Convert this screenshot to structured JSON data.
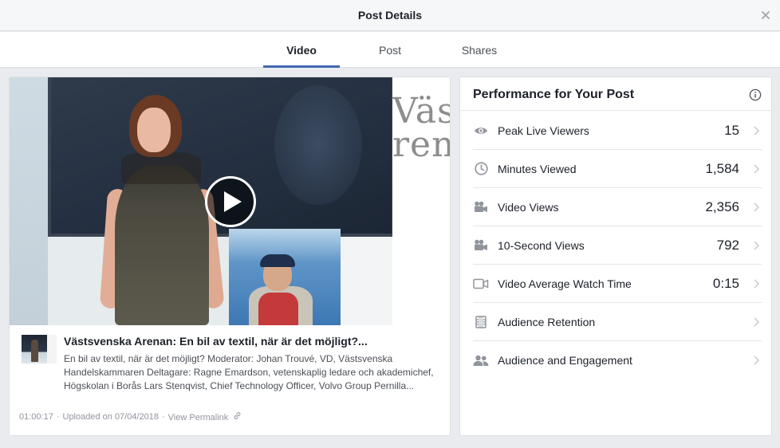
{
  "dialog": {
    "title": "Post Details",
    "close_icon": "close-icon"
  },
  "tabs": [
    {
      "label": "Video",
      "active": true
    },
    {
      "label": "Post",
      "active": false
    },
    {
      "label": "Shares",
      "active": false
    }
  ],
  "video": {
    "banner_text": "Väst\nren",
    "title": "Västsvenska Arenan: En bil av textil, när är det möjligt?...",
    "description": "En bil av textil, när är det möjligt? Moderator: Johan Trouvé, VD, Västsvenska Handelskammaren Deltagare: Ragne Emardson, vetenskaplig ledare och akademichef, Högskolan i Borås Lars Stenqvist, Chief Technology Officer, Volvo Group Pernilla...",
    "duration": "01:00:17",
    "uploaded": "Uploaded on 07/04/2018",
    "permalink_label": "View Permalink",
    "separator": "·"
  },
  "performance": {
    "title": "Performance for Your Post",
    "metrics": [
      {
        "label": "Peak Live Viewers",
        "value": "15",
        "icon": "eye-icon"
      },
      {
        "label": "Minutes Viewed",
        "value": "1,584",
        "icon": "clock-icon"
      },
      {
        "label": "Video Views",
        "value": "2,356",
        "icon": "video-camera-icon"
      },
      {
        "label": "10-Second Views",
        "value": "792",
        "icon": "video-camera-icon"
      },
      {
        "label": "Video Average Watch Time",
        "value": "0:15",
        "icon": "camcorder-icon"
      },
      {
        "label": "Audience Retention",
        "value": "",
        "icon": "film-icon"
      },
      {
        "label": "Audience and Engagement",
        "value": "",
        "icon": "people-icon"
      }
    ]
  },
  "colors": {
    "accent": "#4267b2",
    "text": "#1d2129",
    "muted": "#90949c",
    "icon": "#90949c"
  }
}
